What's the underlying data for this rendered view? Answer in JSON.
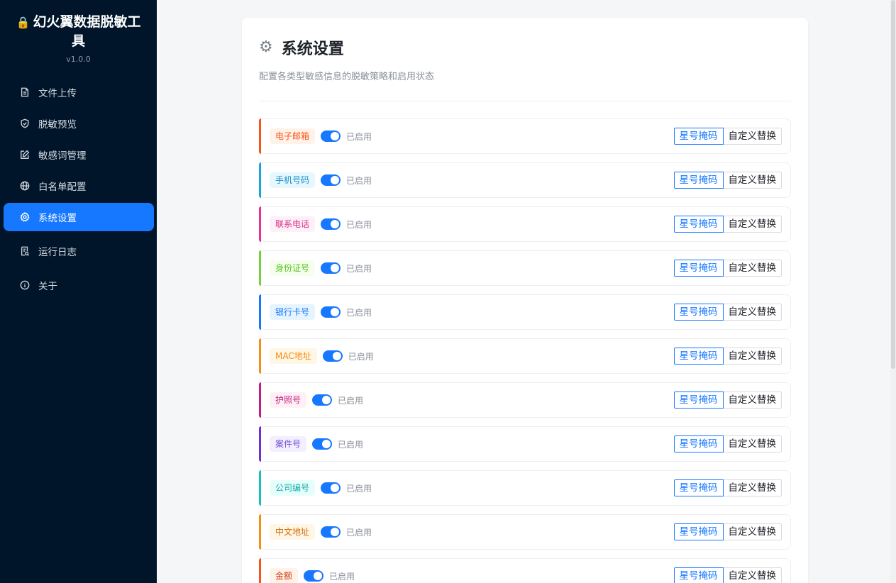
{
  "app": {
    "title": "幻火翼数据脱敏工具",
    "version": "v1.0.0"
  },
  "nav": {
    "items": [
      {
        "label": "文件上传",
        "icon": "file-upload-icon"
      },
      {
        "label": "脱敏预览",
        "icon": "shield-icon"
      },
      {
        "label": "敏感词管理",
        "icon": "edit-icon"
      },
      {
        "label": "白名单配置",
        "icon": "globe-icon"
      },
      {
        "label": "系统设置",
        "icon": "gear-icon",
        "active": true
      },
      {
        "label": "运行日志",
        "icon": "log-icon"
      },
      {
        "label": "关于",
        "icon": "info-icon"
      }
    ]
  },
  "settings": {
    "title": "系统设置",
    "description": "配置各类型敏感信息的脱敏策略和启用状态",
    "mask_label": "星号掩码",
    "custom_label": "自定义替换",
    "rows": [
      {
        "label": "电子邮箱",
        "status": "已启用",
        "enabled": true,
        "accent": "#fa541c",
        "tag_bg": "#fff2e8",
        "tag_fg": "#fa541c"
      },
      {
        "label": "手机号码",
        "status": "已启用",
        "enabled": true,
        "accent": "#13a8d8",
        "tag_bg": "#e6f7ff",
        "tag_fg": "#1890c8"
      },
      {
        "label": "联系电话",
        "status": "已启用",
        "enabled": true,
        "accent": "#eb2f96",
        "tag_bg": "#fff0f6",
        "tag_fg": "#d6318c"
      },
      {
        "label": "身份证号",
        "status": "已启用",
        "enabled": true,
        "accent": "#73d13d",
        "tag_bg": "#f6ffed",
        "tag_fg": "#52c41a"
      },
      {
        "label": "银行卡号",
        "status": "已启用",
        "enabled": true,
        "accent": "#1677ff",
        "tag_bg": "#e6f4ff",
        "tag_fg": "#1677ff"
      },
      {
        "label": "MAC地址",
        "status": "已启用",
        "enabled": true,
        "accent": "#fa8c16",
        "tag_bg": "#fff7e6",
        "tag_fg": "#fa8c16"
      },
      {
        "label": "护照号",
        "status": "已启用",
        "enabled": true,
        "accent": "#c41d7f",
        "tag_bg": "#fff0f6",
        "tag_fg": "#c41d7f"
      },
      {
        "label": "案件号",
        "status": "已启用",
        "enabled": true,
        "accent": "#722ed1",
        "tag_bg": "#f3efff",
        "tag_fg": "#6e4ad8"
      },
      {
        "label": "公司编号",
        "status": "已启用",
        "enabled": true,
        "accent": "#13c2c2",
        "tag_bg": "#e6fffb",
        "tag_fg": "#13a8a8"
      },
      {
        "label": "中文地址",
        "status": "已启用",
        "enabled": true,
        "accent": "#fa8c16",
        "tag_bg": "#fff7e6",
        "tag_fg": "#d46b08"
      },
      {
        "label": "金额",
        "status": "已启用",
        "enabled": true,
        "accent": "#fa541c",
        "tag_bg": "#fff2e8",
        "tag_fg": "#d4380d"
      }
    ]
  }
}
